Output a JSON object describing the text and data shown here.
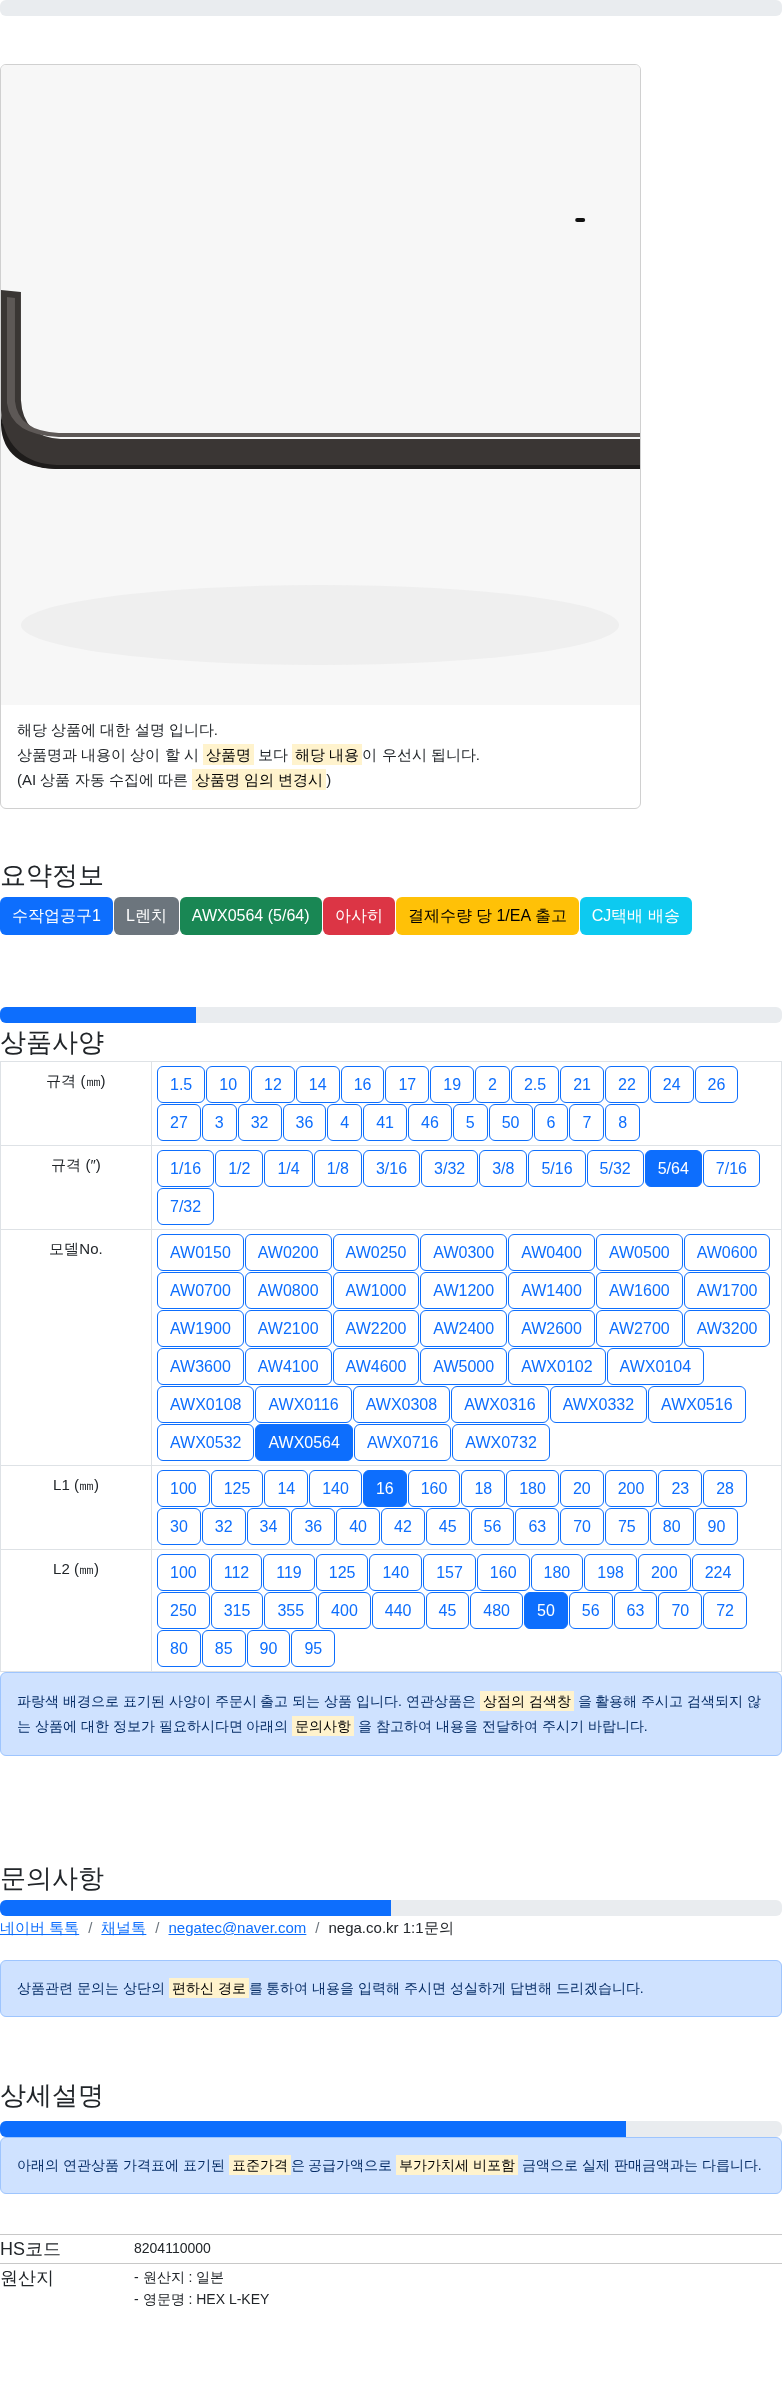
{
  "product_card": {
    "picture": {
      "kind": "picture"
    },
    "notice_lines": [
      [
        {
          "text": "해당 상품에 대한 설명 입니다.",
          "highlight": false
        }
      ],
      [
        {
          "text": "상품명과 내용이 상이 할 시 ",
          "highlight": false
        },
        {
          "text": "상품명",
          "highlight": true
        },
        {
          "text": " 보다 ",
          "highlight": false
        },
        {
          "text": "해당 내용",
          "highlight": true
        },
        {
          "text": "이 우선시 됩니다.",
          "highlight": false
        }
      ],
      [
        {
          "text": "(AI 상품 자동 수집에 따른 ",
          "highlight": false
        },
        {
          "text": "상품명 임의 변경시",
          "highlight": true
        },
        {
          "text": ")",
          "highlight": false
        }
      ]
    ]
  },
  "summary": {
    "title": "요약정보",
    "badges": [
      {
        "label": "수작업공구1",
        "color": "#0d6efd"
      },
      {
        "label": "L렌치",
        "color": "#6c757d"
      },
      {
        "label": "AWX0564 (5/64)",
        "color": "#198754"
      },
      {
        "label": "아사히",
        "color": "#dc3545"
      },
      {
        "label": "결제수량 당 1/EA 출고",
        "color": "#ffc107"
      },
      {
        "label": "CJ택배 배송",
        "color": "#0dcaf0"
      }
    ]
  },
  "specs": {
    "level": 0.25,
    "title": "상품사양",
    "rows": [
      {
        "label": "규격 (㎜)",
        "options": [
          {
            "label": "1.5",
            "selected": false
          },
          {
            "label": "10",
            "selected": false
          },
          {
            "label": "12",
            "selected": false
          },
          {
            "label": "14",
            "selected": false
          },
          {
            "label": "16",
            "selected": false
          },
          {
            "label": "17",
            "selected": false
          },
          {
            "label": "19",
            "selected": false
          },
          {
            "label": "2",
            "selected": false
          },
          {
            "label": "2.5",
            "selected": false
          },
          {
            "label": "21",
            "selected": false
          },
          {
            "label": "22",
            "selected": false
          },
          {
            "label": "24",
            "selected": false
          },
          {
            "label": "26",
            "selected": false
          },
          {
            "label": "27",
            "selected": false
          },
          {
            "label": "3",
            "selected": false
          },
          {
            "label": "32",
            "selected": false
          },
          {
            "label": "36",
            "selected": false
          },
          {
            "label": "4",
            "selected": false
          },
          {
            "label": "41",
            "selected": false
          },
          {
            "label": "46",
            "selected": false
          },
          {
            "label": "5",
            "selected": false
          },
          {
            "label": "50",
            "selected": false
          },
          {
            "label": "6",
            "selected": false
          },
          {
            "label": "7",
            "selected": false
          },
          {
            "label": "8",
            "selected": false
          }
        ]
      },
      {
        "label": "규격 (″)",
        "options": [
          {
            "label": "1/16",
            "selected": false
          },
          {
            "label": "1/2",
            "selected": false
          },
          {
            "label": "1/4",
            "selected": false
          },
          {
            "label": "1/8",
            "selected": false
          },
          {
            "label": "3/16",
            "selected": false
          },
          {
            "label": "3/32",
            "selected": false
          },
          {
            "label": "3/8",
            "selected": false
          },
          {
            "label": "5/16",
            "selected": false
          },
          {
            "label": "5/32",
            "selected": false
          },
          {
            "label": "5/64",
            "selected": true
          },
          {
            "label": "7/16",
            "selected": false
          },
          {
            "label": "7/32",
            "selected": false
          }
        ]
      },
      {
        "label": "모델No.",
        "options": [
          {
            "label": "AW0150",
            "selected": false
          },
          {
            "label": "AW0200",
            "selected": false
          },
          {
            "label": "AW0250",
            "selected": false
          },
          {
            "label": "AW0300",
            "selected": false
          },
          {
            "label": "AW0400",
            "selected": false
          },
          {
            "label": "AW0500",
            "selected": false
          },
          {
            "label": "AW0600",
            "selected": false
          },
          {
            "label": "AW0700",
            "selected": false
          },
          {
            "label": "AW0800",
            "selected": false
          },
          {
            "label": "AW1000",
            "selected": false
          },
          {
            "label": "AW1200",
            "selected": false
          },
          {
            "label": "AW1400",
            "selected": false
          },
          {
            "label": "AW1600",
            "selected": false
          },
          {
            "label": "AW1700",
            "selected": false
          },
          {
            "label": "AW1900",
            "selected": false
          },
          {
            "label": "AW2100",
            "selected": false
          },
          {
            "label": "AW2200",
            "selected": false
          },
          {
            "label": "AW2400",
            "selected": false
          },
          {
            "label": "AW2600",
            "selected": false
          },
          {
            "label": "AW2700",
            "selected": false
          },
          {
            "label": "AW3200",
            "selected": false
          },
          {
            "label": "AW3600",
            "selected": false
          },
          {
            "label": "AW4100",
            "selected": false
          },
          {
            "label": "AW4600",
            "selected": false
          },
          {
            "label": "AW5000",
            "selected": false
          },
          {
            "label": "AWX0102",
            "selected": false
          },
          {
            "label": "AWX0104",
            "selected": false
          },
          {
            "label": "AWX0108",
            "selected": false
          },
          {
            "label": "AWX0116",
            "selected": false
          },
          {
            "label": "AWX0308",
            "selected": false
          },
          {
            "label": "AWX0316",
            "selected": false
          },
          {
            "label": "AWX0332",
            "selected": false
          },
          {
            "label": "AWX0516",
            "selected": false
          },
          {
            "label": "AWX0532",
            "selected": false
          },
          {
            "label": "AWX0564",
            "selected": true
          },
          {
            "label": "AWX0716",
            "selected": false
          },
          {
            "label": "AWX0732",
            "selected": false
          }
        ]
      },
      {
        "label": "L1 (㎜)",
        "options": [
          {
            "label": "100",
            "selected": false
          },
          {
            "label": "125",
            "selected": false
          },
          {
            "label": "14",
            "selected": false
          },
          {
            "label": "140",
            "selected": false
          },
          {
            "label": "16",
            "selected": true
          },
          {
            "label": "160",
            "selected": false
          },
          {
            "label": "18",
            "selected": false
          },
          {
            "label": "180",
            "selected": false
          },
          {
            "label": "20",
            "selected": false
          },
          {
            "label": "200",
            "selected": false
          },
          {
            "label": "23",
            "selected": false
          },
          {
            "label": "28",
            "selected": false
          },
          {
            "label": "30",
            "selected": false
          },
          {
            "label": "32",
            "selected": false
          },
          {
            "label": "34",
            "selected": false
          },
          {
            "label": "36",
            "selected": false
          },
          {
            "label": "40",
            "selected": false
          },
          {
            "label": "42",
            "selected": false
          },
          {
            "label": "45",
            "selected": false
          },
          {
            "label": "56",
            "selected": false
          },
          {
            "label": "63",
            "selected": false
          },
          {
            "label": "70",
            "selected": false
          },
          {
            "label": "75",
            "selected": false
          },
          {
            "label": "80",
            "selected": false
          },
          {
            "label": "90",
            "selected": false
          }
        ]
      },
      {
        "label": "L2 (㎜)",
        "options": [
          {
            "label": "100",
            "selected": false
          },
          {
            "label": "112",
            "selected": false
          },
          {
            "label": "119",
            "selected": false
          },
          {
            "label": "125",
            "selected": false
          },
          {
            "label": "140",
            "selected": false
          },
          {
            "label": "157",
            "selected": false
          },
          {
            "label": "160",
            "selected": false
          },
          {
            "label": "180",
            "selected": false
          },
          {
            "label": "198",
            "selected": false
          },
          {
            "label": "200",
            "selected": false
          },
          {
            "label": "224",
            "selected": false
          },
          {
            "label": "250",
            "selected": false
          },
          {
            "label": "315",
            "selected": false
          },
          {
            "label": "355",
            "selected": false
          },
          {
            "label": "400",
            "selected": false
          },
          {
            "label": "440",
            "selected": false
          },
          {
            "label": "45",
            "selected": false
          },
          {
            "label": "480",
            "selected": false
          },
          {
            "label": "50",
            "selected": true
          },
          {
            "label": "56",
            "selected": false
          },
          {
            "label": "63",
            "selected": false
          },
          {
            "label": "70",
            "selected": false
          },
          {
            "label": "72",
            "selected": false
          },
          {
            "label": "80",
            "selected": false
          },
          {
            "label": "85",
            "selected": false
          },
          {
            "label": "90",
            "selected": false
          },
          {
            "label": "95",
            "selected": false
          }
        ]
      }
    ],
    "notice": [
      {
        "text": "파랑색 배경으로 표기된 사양이 주문시 출고 되는 상품 입니다. 연관상품은 ",
        "highlight": false
      },
      {
        "text": "상점의 검색창",
        "highlight": true
      },
      {
        "text": " 을 활용해 주시고 검색되지 않는 상품에 대한 정보가 필요하시다면 아래의 ",
        "highlight": false
      },
      {
        "text": "문의사항",
        "highlight": true
      },
      {
        "text": " 을 참고하여 내용을 전달하여 주시기 바랍니다.",
        "highlight": false
      }
    ]
  },
  "contact": {
    "title": "문의사항",
    "level": 0.5,
    "links": [
      {
        "kind": "link",
        "label": "네이버 톡톡"
      },
      {
        "kind": "separator",
        "label": "/"
      },
      {
        "kind": "link",
        "label": "채널톡"
      },
      {
        "kind": "separator",
        "label": "/"
      },
      {
        "kind": "link",
        "label": "negatec@naver.com"
      },
      {
        "kind": "separator",
        "label": "/"
      },
      {
        "kind": "text",
        "label": "nega.co.kr 1:1문의"
      }
    ],
    "notice": [
      {
        "text": "상품관련 문의는 상단의 ",
        "highlight": false
      },
      {
        "text": "편하신 경로",
        "highlight": true
      },
      {
        "text": "를 통하여 내용을 입력해 주시면 성실하게 답변해 드리겠습니다.",
        "highlight": false
      }
    ]
  },
  "detail": {
    "title": "상세설명",
    "level": 0.8,
    "notice": [
      {
        "text": "아래의 연관상품 가격표에 표기된 ",
        "highlight": false
      },
      {
        "text": "표준가격",
        "highlight": true
      },
      {
        "text": "은 공급가액으로 ",
        "highlight": false
      },
      {
        "text": "부가가치세 비포함",
        "highlight": true
      },
      {
        "text": " 금액으로 실제 판매금액과는 다릅니다.",
        "highlight": false
      }
    ],
    "info": [
      {
        "label": "HS코드",
        "lines": [
          "8204110000"
        ]
      },
      {
        "label": "원산지",
        "lines": [
          "- 원산지 : 일본",
          "- 영문명 : HEX L-KEY"
        ]
      }
    ]
  }
}
